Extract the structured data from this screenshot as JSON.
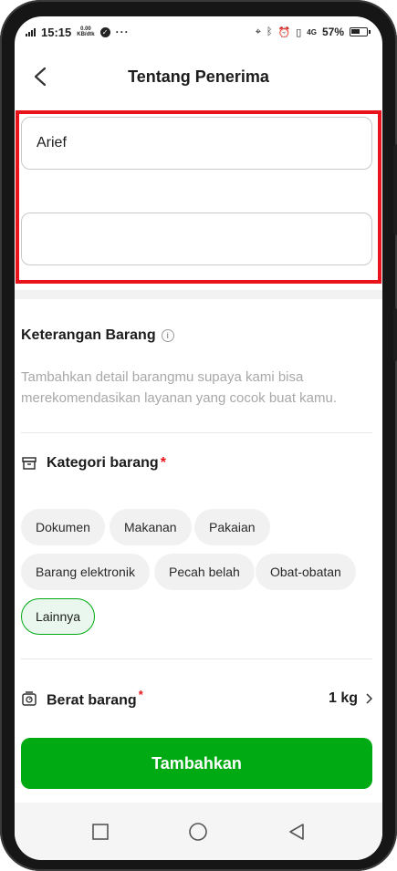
{
  "status_bar": {
    "time": "15:15",
    "speed_value": "0.00",
    "speed_unit": "KB/dtk",
    "more": "···",
    "network": "4G",
    "battery": "57%",
    "battery_level": 0.57
  },
  "header": {
    "title": "Tentang Penerima"
  },
  "form": {
    "name_value": "Arief",
    "second_value": ""
  },
  "keterangan": {
    "title": "Keterangan Barang",
    "description": "Tambahkan detail barangmu supaya kami bisa merekomendasikan layanan yang cocok buat kamu."
  },
  "kategori": {
    "title": "Kategori barang",
    "required_mark": "*",
    "chips": [
      "Dokumen",
      "Makanan",
      "Pakaian",
      "Barang elektronik",
      "Pecah belah",
      "Obat-obatan",
      "Lainnya"
    ],
    "selected": "Lainnya"
  },
  "berat": {
    "title": "Berat barang",
    "required_mark": "*",
    "value": "1 kg"
  },
  "cta": {
    "label": "Tambahkan"
  },
  "colors": {
    "accent": "#00aa13",
    "highlight": "#e8131b",
    "required": "#e8131b"
  }
}
